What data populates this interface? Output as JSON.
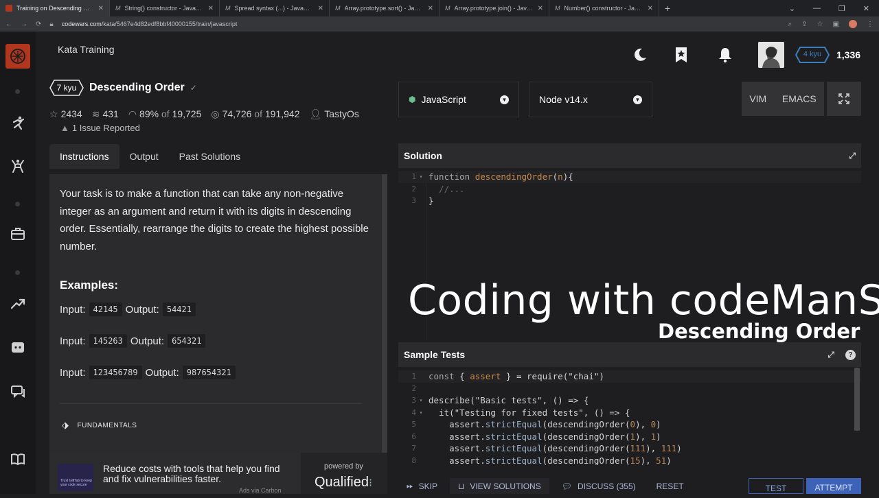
{
  "browser": {
    "tabs": [
      {
        "title": "Training on Descending Order | C",
        "favicon": "codewars-icon",
        "active": true
      },
      {
        "title": "String() constructor - JavaScript |",
        "favicon": "M"
      },
      {
        "title": "Spread syntax (...) - JavaScript | M",
        "favicon": "M"
      },
      {
        "title": "Array.prototype.sort() - JavaScri",
        "favicon": "M"
      },
      {
        "title": "Array.prototype.join() - JavaScr",
        "favicon": "M"
      },
      {
        "title": "Number() constructor - JavaScri",
        "favicon": "M"
      }
    ],
    "new_tab": "+",
    "close": "✕",
    "url_domain": "codewars.com",
    "url_path": "/kata/5467e4d82edf8bbf40000155/train/javascript"
  },
  "topbar": {
    "title": "Kata Training",
    "honor": "1,336",
    "rank": "4 kyu"
  },
  "kata": {
    "rank": "7 kyu",
    "title": "Descending Order",
    "stats": {
      "stars": "2434",
      "collections": "431",
      "satisfaction": "89%",
      "satisfaction_of": "of",
      "satisfaction_total": "19,725",
      "completed": "74,726",
      "completed_of": "of",
      "completed_total": "191,942",
      "author": "TastyOs"
    },
    "issues": "1 Issue Reported"
  },
  "instructions": {
    "tabs": [
      "Instructions",
      "Output",
      "Past Solutions"
    ],
    "description": "Your task is to make a function that can take any non-negative integer as an argument and return it with its digits in descending order. Essentially, rearrange the digits to create the highest possible number.",
    "examples_title": "Examples:",
    "input_label": "Input:",
    "output_label": "Output:",
    "examples": [
      {
        "input": "42145",
        "output": "54421"
      },
      {
        "input": "145263",
        "output": "654321"
      },
      {
        "input": "123456789",
        "output": "987654321"
      }
    ],
    "tag": "FUNDAMENTALS"
  },
  "ad": {
    "image_text": "Trust GitHub to keep your code secure",
    "text": "Reduce costs with tools that help you find and fix vulnerabilities faster.",
    "by": "Ads via Carbon",
    "powered_by": "powered by",
    "brand": "Qualified"
  },
  "editor": {
    "language": "JavaScript",
    "version": "Node v14.x",
    "modes": [
      "VIM",
      "EMACS"
    ],
    "solution_title": "Solution",
    "solution_lines": [
      [
        {
          "t": "function ",
          "c": "c-kw"
        },
        {
          "t": "descendingOrder",
          "c": "c-fn"
        },
        {
          "t": "(",
          "c": ""
        },
        {
          "t": "n",
          "c": "c-var"
        },
        {
          "t": "){",
          "c": ""
        }
      ],
      [
        {
          "t": "  //...",
          "c": "c-cm"
        }
      ],
      [
        {
          "t": "}",
          "c": ""
        }
      ]
    ],
    "tests_title": "Sample Tests",
    "test_lines": [
      [
        {
          "t": "const ",
          "c": "c-kw"
        },
        {
          "t": "{ ",
          "c": ""
        },
        {
          "t": "assert",
          "c": "c-var"
        },
        {
          "t": " } = ",
          "c": ""
        },
        {
          "t": "require",
          "c": ""
        },
        {
          "t": "(\"chai\")",
          "c": "c-str"
        }
      ],
      [],
      [
        {
          "t": "describe",
          "c": ""
        },
        {
          "t": "(\"Basic tests\", () => {",
          "c": "c-str"
        }
      ],
      [
        {
          "t": "  it",
          "c": ""
        },
        {
          "t": "(\"Testing for fixed tests\", () => {",
          "c": "c-str"
        }
      ],
      [
        {
          "t": "    assert",
          "c": ""
        },
        {
          "t": ".",
          "c": ""
        },
        {
          "t": "strictEqual",
          "c": "c-prop"
        },
        {
          "t": "(descendingOrder(",
          "c": ""
        },
        {
          "t": "0",
          "c": "c-num"
        },
        {
          "t": "), ",
          "c": ""
        },
        {
          "t": "0",
          "c": "c-num"
        },
        {
          "t": ")",
          "c": ""
        }
      ],
      [
        {
          "t": "    assert",
          "c": ""
        },
        {
          "t": ".",
          "c": ""
        },
        {
          "t": "strictEqual",
          "c": "c-prop"
        },
        {
          "t": "(descendingOrder(",
          "c": ""
        },
        {
          "t": "1",
          "c": "c-num"
        },
        {
          "t": "), ",
          "c": ""
        },
        {
          "t": "1",
          "c": "c-num"
        },
        {
          "t": ")",
          "c": ""
        }
      ],
      [
        {
          "t": "    assert",
          "c": ""
        },
        {
          "t": ".",
          "c": ""
        },
        {
          "t": "strictEqual",
          "c": "c-prop"
        },
        {
          "t": "(descendingOrder(",
          "c": ""
        },
        {
          "t": "111",
          "c": "c-num"
        },
        {
          "t": "), ",
          "c": ""
        },
        {
          "t": "111",
          "c": "c-num"
        },
        {
          "t": ")",
          "c": ""
        }
      ],
      [
        {
          "t": "    assert",
          "c": ""
        },
        {
          "t": ".",
          "c": ""
        },
        {
          "t": "strictEqual",
          "c": "c-prop"
        },
        {
          "t": "(descendingOrder(",
          "c": ""
        },
        {
          "t": "15",
          "c": "c-num"
        },
        {
          "t": "), ",
          "c": ""
        },
        {
          "t": "51",
          "c": "c-num"
        },
        {
          "t": ")",
          "c": ""
        }
      ]
    ]
  },
  "overlay": {
    "title": "Coding with codeManS",
    "subtitle": "Descending Order"
  },
  "actions": {
    "skip": "SKIP",
    "view_solutions": "VIEW SOLUTIONS",
    "discuss": "DISCUSS (355)",
    "reset": "RESET",
    "test": "TEST",
    "attempt": "ATTEMPT"
  },
  "colors": {
    "brand": "#b1361e",
    "accent": "#3d62b8",
    "rank_blue": "#3c7ebb"
  }
}
